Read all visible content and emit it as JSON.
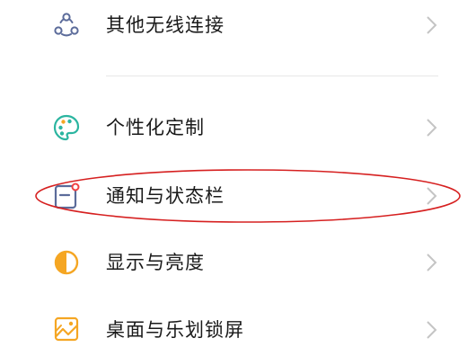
{
  "settings": {
    "items": [
      {
        "label": "其他无线连接",
        "icon": "connections-icon"
      },
      {
        "label": "个性化定制",
        "icon": "palette-icon"
      },
      {
        "label": "通知与状态栏",
        "icon": "notification-icon"
      },
      {
        "label": "显示与亮度",
        "icon": "brightness-icon"
      },
      {
        "label": "桌面与乐划锁屏",
        "icon": "wallpaper-icon"
      }
    ]
  },
  "colors": {
    "text": "#1a1a1a",
    "chevron": "#c4c4c4",
    "divider": "#e8e8e8",
    "connections_icon": "#5b6b9a",
    "palette_icon": "#2bb5a0",
    "notification_icon": "#5b6b9a",
    "notification_dot": "#f04040",
    "brightness_icon": "#f5a623",
    "wallpaper_icon": "#f5a623",
    "annotation_ellipse": "#d62020"
  }
}
